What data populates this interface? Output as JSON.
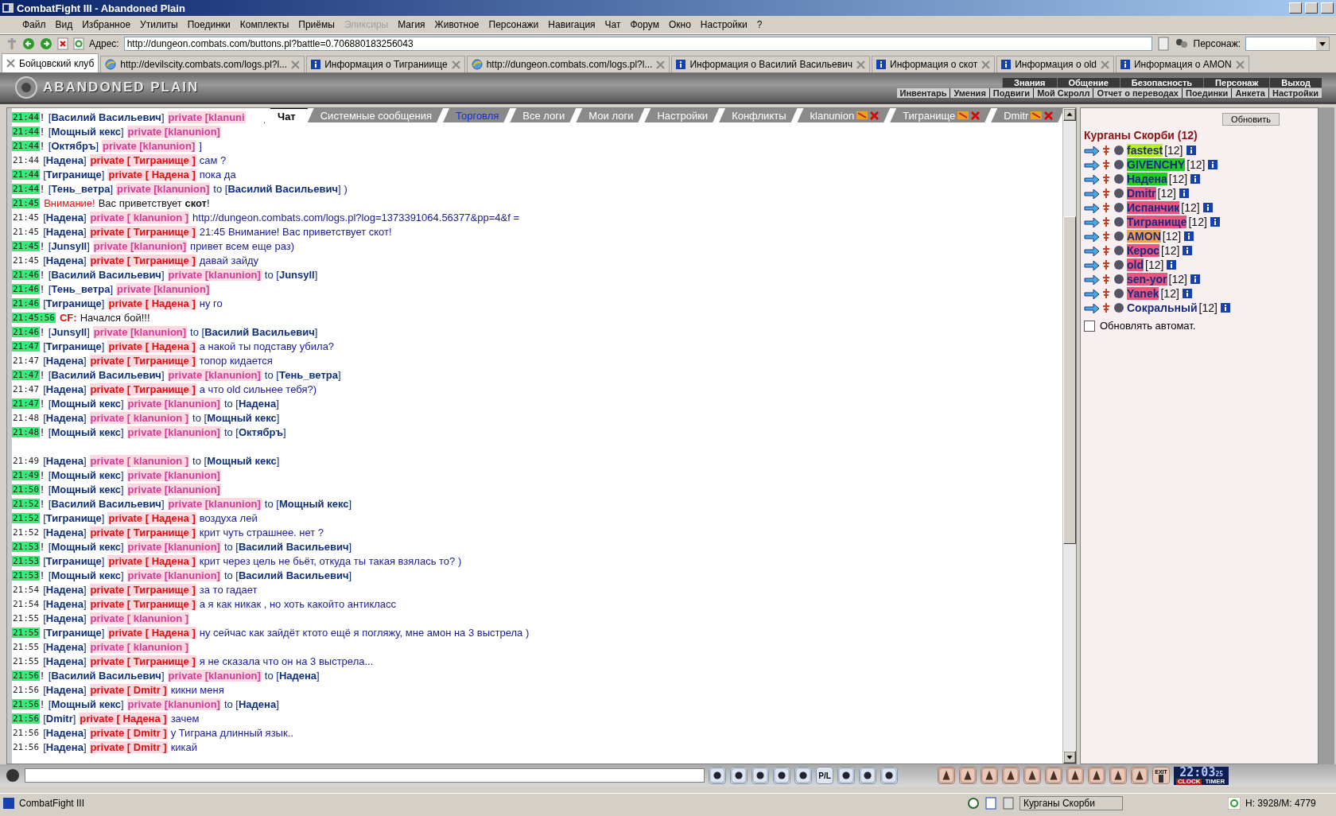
{
  "window": {
    "title": "CombatFight III - Abandoned Plain"
  },
  "menu": [
    {
      "label": "Файл",
      "disabled": false
    },
    {
      "label": "Вид",
      "disabled": false
    },
    {
      "label": "Избранное",
      "disabled": false
    },
    {
      "label": "Утилиты",
      "disabled": false
    },
    {
      "label": "Поединки",
      "disabled": false
    },
    {
      "label": "Комплекты",
      "disabled": false
    },
    {
      "label": "Приёмы",
      "disabled": false
    },
    {
      "label": "Эликсиры",
      "disabled": true
    },
    {
      "label": "Магия",
      "disabled": false
    },
    {
      "label": "Животное",
      "disabled": false
    },
    {
      "label": "Персонажи",
      "disabled": false
    },
    {
      "label": "Навигация",
      "disabled": false
    },
    {
      "label": "Чат",
      "disabled": false
    },
    {
      "label": "Форум",
      "disabled": false
    },
    {
      "label": "Окно",
      "disabled": false
    },
    {
      "label": "Настройки",
      "disabled": false
    },
    {
      "label": "?",
      "disabled": false
    }
  ],
  "toolbar": {
    "address_label": "Адрес:",
    "address": "http://dungeon.combats.com/buttons.pl?battle=0.706880183256043",
    "character_label": "Персонаж:"
  },
  "browser_tabs": [
    {
      "label": "Бойцовский клуб",
      "kind": "main",
      "selected": true
    },
    {
      "label": "http://devilscity.combats.com/logs.pl?l...",
      "kind": "web",
      "selected": false
    },
    {
      "label": "Информация о Тиграниище",
      "kind": "info",
      "selected": false
    },
    {
      "label": "http://dungeon.combats.com/logs.pl?l...",
      "kind": "web",
      "selected": false
    },
    {
      "label": "Информация о Василий Васильевич",
      "kind": "info",
      "selected": false
    },
    {
      "label": "Информация о скот",
      "kind": "info",
      "selected": false
    },
    {
      "label": "Информация о old",
      "kind": "info",
      "selected": false
    },
    {
      "label": "Информация о AMON",
      "kind": "info",
      "selected": false
    }
  ],
  "game": {
    "logo": "ABANDONED PLAIN",
    "nav_top": [
      "Знания",
      "Общение",
      "Безопасность",
      "Персонаж",
      "Выход"
    ],
    "nav_bottom": [
      "Инвентарь",
      "Умения",
      "Подвиги",
      "Мой Скролл",
      "Отчет о переводах",
      "Поединки",
      "Анкета",
      "Настройки"
    ]
  },
  "chat_tabs": [
    {
      "label": "Чат",
      "kind": "plain",
      "selected": true
    },
    {
      "label": "Системные сообщения",
      "kind": "plain",
      "selected": false
    },
    {
      "label": "Торговля",
      "kind": "link",
      "selected": false
    },
    {
      "label": "Все логи",
      "kind": "plain",
      "selected": false
    },
    {
      "label": "Мои логи",
      "kind": "plain",
      "selected": false
    },
    {
      "label": "Настройки",
      "kind": "plain",
      "selected": false
    },
    {
      "label": "Конфликты",
      "kind": "plain",
      "selected": false
    },
    {
      "label": "klanunion",
      "kind": "private",
      "selected": false
    },
    {
      "label": "Тигранище",
      "kind": "private",
      "selected": false
    },
    {
      "label": "Dmitr",
      "kind": "private",
      "selected": false
    }
  ],
  "messages": [
    {
      "kind": "private",
      "time": "21:44",
      "highlighted": true,
      "bang": "!",
      "sender": "[**Василий Васильевич**]",
      "channel": "private [klanuni",
      "personal": false
    },
    {
      "kind": "private",
      "time": "21:44",
      "highlighted": true,
      "bang": "!",
      "sender": "[**Мощный кекс**]",
      "channel": "private [klanunion]",
      "personal": false
    },
    {
      "kind": "private",
      "time": "21:44",
      "highlighted": true,
      "bang": "!",
      "sender": "[**Октябръ**]",
      "channel": "private [klanunion]",
      "personal": false,
      "text": "]"
    },
    {
      "kind": "private",
      "time": "21:44",
      "highlighted": false,
      "sender": "[**Надена**]",
      "channel": "private [ Тигранище ]",
      "personal": true,
      "text": "сам ?"
    },
    {
      "kind": "private",
      "time": "21:44",
      "highlighted": true,
      "sender": "[**Тигранище**]",
      "channel": "private [ Надена ]",
      "personal": true,
      "text": "пока да"
    },
    {
      "kind": "private",
      "time": "21:44",
      "highlighted": true,
      "bang": "!",
      "sender": "[**Тень_ветра**]",
      "channel": "private [klanunion]",
      "personal": false,
      "recipient": "to [**Василий Васильевич**]",
      "text": ")"
    },
    {
      "kind": "system",
      "time": "21:45",
      "highlighted": true,
      "label": "Внимание!",
      "text": "Вас приветствует **скот**!"
    },
    {
      "kind": "private",
      "time": "21:45",
      "highlighted": false,
      "sender": "[**Надена**]",
      "channel": "private [ klanunion ]",
      "personal": false,
      "text": "http://dungeon.combats.com/logs.pl?log=1373391064.56377&pp=4&f ="
    },
    {
      "kind": "private",
      "time": "21:45",
      "highlighted": false,
      "sender": "[**Надена**]",
      "channel": "private [ Тигранище ]",
      "personal": true,
      "text": "21:45 Внимание! Вас приветствует скот!"
    },
    {
      "kind": "private",
      "time": "21:45",
      "highlighted": true,
      "bang": "!",
      "sender": "[**Junsyll**]",
      "channel": "private [klanunion]",
      "personal": false,
      "text": "привет всем еще раз)"
    },
    {
      "kind": "private",
      "time": "21:45",
      "highlighted": false,
      "sender": "[**Надена**]",
      "channel": "private [ Тигранище ]",
      "personal": true,
      "text": "давай зайду"
    },
    {
      "kind": "private",
      "time": "21:46",
      "highlighted": true,
      "bang": "!",
      "sender": "[**Василий Васильевич**]",
      "channel": "private [klanunion]",
      "personal": false,
      "recipient": "to [**Junsyll**]"
    },
    {
      "kind": "private",
      "time": "21:46",
      "highlighted": true,
      "bang": "!",
      "sender": "[**Тень_ветра**]",
      "channel": "private [klanunion]",
      "personal": false
    },
    {
      "kind": "private",
      "time": "21:46",
      "highlighted": true,
      "sender": "[**Тигранище**]",
      "channel": "private [ Надена ]",
      "personal": true,
      "text": "ну го"
    },
    {
      "kind": "system",
      "time": "21:45:56",
      "highlighted": true,
      "label": "CF:",
      "text": "Начался бой!!!"
    },
    {
      "kind": "private",
      "time": "21:46",
      "highlighted": true,
      "bang": "!",
      "sender": "[**Junsyll**]",
      "channel": "private [klanunion]",
      "personal": false,
      "recipient": "to [**Василий Васильевич**]"
    },
    {
      "kind": "private",
      "time": "21:47",
      "highlighted": true,
      "sender": "[**Тигранище**]",
      "channel": "private [ Надена ]",
      "personal": true,
      "text": "а накой ты подставу убила?"
    },
    {
      "kind": "private",
      "time": "21:47",
      "highlighted": false,
      "sender": "[**Надена**]",
      "channel": "private [ Тигранище ]",
      "personal": true,
      "text": "топор кидается"
    },
    {
      "kind": "private",
      "time": "21:47",
      "highlighted": true,
      "bang": "!",
      "sender": "[**Василий Васильевич**]",
      "channel": "private [klanunion]",
      "personal": false,
      "recipient": "to [**Тень_ветра**]"
    },
    {
      "kind": "private",
      "time": "21:47",
      "highlighted": false,
      "sender": "[**Надена**]",
      "channel": "private [ Тигранище ]",
      "personal": true,
      "text": "а что old сильнее тебя?)"
    },
    {
      "kind": "private",
      "time": "21:47",
      "highlighted": true,
      "bang": "!",
      "sender": "[**Мощный кекс**]",
      "channel": "private [klanunion]",
      "personal": false,
      "recipient": "to [**Надена**]"
    },
    {
      "kind": "private",
      "time": "21:48",
      "highlighted": false,
      "sender": "[**Надена**]",
      "channel": "private [ klanunion ]",
      "personal": false,
      "recipient": "to [**Мощный кекс**]"
    },
    {
      "kind": "private",
      "time": "21:48",
      "highlighted": true,
      "bang": "!",
      "sender": "[**Мощный кекс**]",
      "channel": "private [klanunion]",
      "personal": false,
      "recipient": "to [**Октябръ**]"
    },
    {
      "kind": "gap"
    },
    {
      "kind": "private",
      "time": "21:49",
      "highlighted": false,
      "sender": "[**Надена**]",
      "channel": "private [ klanunion ]",
      "personal": false,
      "recipient": "to [**Мощный кекс**]"
    },
    {
      "kind": "private",
      "time": "21:49",
      "highlighted": true,
      "bang": "!",
      "sender": "[**Мощный кекс**]",
      "channel": "private [klanunion]",
      "personal": false
    },
    {
      "kind": "private",
      "time": "21:50",
      "highlighted": true,
      "bang": "!",
      "sender": "[**Мощный кекс**]",
      "channel": "private [klanunion]",
      "personal": false
    },
    {
      "kind": "private",
      "time": "21:52",
      "highlighted": true,
      "bang": "!",
      "sender": "[**Василий Васильевич**]",
      "channel": "private [klanunion]",
      "personal": false,
      "recipient": "to [**Мощный кекс**]"
    },
    {
      "kind": "private",
      "time": "21:52",
      "highlighted": true,
      "sender": "[**Тигранище**]",
      "channel": "private [ Надена ]",
      "personal": true,
      "text": "воздуха лей"
    },
    {
      "kind": "private",
      "time": "21:52",
      "highlighted": false,
      "sender": "[**Надена**]",
      "channel": "private [ Тигранище ]",
      "personal": true,
      "text": "крит чуть страшнее. нет ?"
    },
    {
      "kind": "private",
      "time": "21:53",
      "highlighted": true,
      "bang": "!",
      "sender": "[**Мощный кекс**]",
      "channel": "private [klanunion]",
      "personal": false,
      "recipient": "to [**Василий Васильевич**]"
    },
    {
      "kind": "private",
      "time": "21:53",
      "highlighted": true,
      "sender": "[**Тигранище**]",
      "channel": "private [ Надена ]",
      "personal": true,
      "text": "крит через цель не бьёт, откуда ты такая взялась то? )"
    },
    {
      "kind": "private",
      "time": "21:53",
      "highlighted": true,
      "bang": "!",
      "sender": "[**Мощный кекс**]",
      "channel": "private [klanunion]",
      "personal": false,
      "recipient": "to [**Василий Васильевич**]"
    },
    {
      "kind": "private",
      "time": "21:54",
      "highlighted": false,
      "sender": "[**Надена**]",
      "channel": "private [ Тигранище ]",
      "personal": true,
      "text": "за то гадает"
    },
    {
      "kind": "private",
      "time": "21:54",
      "highlighted": false,
      "sender": "[**Надена**]",
      "channel": "private [ Тигранище ]",
      "personal": true,
      "text": "а я как никак , но хоть какойто антикласс"
    },
    {
      "kind": "private",
      "time": "21:55",
      "highlighted": false,
      "sender": "[**Надена**]",
      "channel": "private [ klanunion ]",
      "personal": false
    },
    {
      "kind": "private",
      "time": "21:55",
      "highlighted": true,
      "sender": "[**Тигранище**]",
      "channel": "private [ Надена ]",
      "personal": true,
      "text": "ну сейчас как зайдёт ктото ещё я погляжу, мне амон на 3 выстрела )"
    },
    {
      "kind": "private",
      "time": "21:55",
      "highlighted": false,
      "sender": "[**Надена**]",
      "channel": "private [ klanunion ]",
      "personal": false
    },
    {
      "kind": "private",
      "time": "21:55",
      "highlighted": false,
      "sender": "[**Надена**]",
      "channel": "private [ Тигранище ]",
      "personal": true,
      "text": "я не сказала что он на 3 выстрела..."
    },
    {
      "kind": "private",
      "time": "21:56",
      "highlighted": true,
      "bang": "!",
      "sender": "[**Василий Васильевич**]",
      "channel": "private [klanunion]",
      "personal": false,
      "recipient": "to [**Надена**]"
    },
    {
      "kind": "private",
      "time": "21:56",
      "highlighted": false,
      "sender": "[**Надена**]",
      "channel": "private [ Dmitr ]",
      "personal": true,
      "text": "кикни меня"
    },
    {
      "kind": "private",
      "time": "21:56",
      "highlighted": true,
      "bang": "!",
      "sender": "[**Мощный кекс**]",
      "channel": "private [klanunion]",
      "personal": false,
      "recipient": "to [**Надена**]"
    },
    {
      "kind": "private",
      "time": "21:56",
      "highlighted": true,
      "sender": "[**Dmitr**]",
      "channel": "private [ Надена ]",
      "personal": true,
      "text": "зачем"
    },
    {
      "kind": "private",
      "time": "21:56",
      "highlighted": false,
      "sender": "[**Надена**]",
      "channel": "private [ Dmitr ]",
      "personal": true,
      "text": "у Тиграна длинный язык.."
    },
    {
      "kind": "private",
      "time": "21:56",
      "highlighted": false,
      "sender": "[**Надена**]",
      "channel": "private [ Dmitr ]",
      "personal": true,
      "text": "кикай"
    }
  ],
  "room": {
    "refresh": "Обновить",
    "title": "Курганы Скорби (12)",
    "players": [
      {
        "name": "fastest",
        "level": "[12]",
        "color": "#b8f020"
      },
      {
        "name": "GIVENCHY",
        "level": "[12]",
        "color": "#22cc22"
      },
      {
        "name": "Надена",
        "level": "[12]",
        "color": "#22cc22"
      },
      {
        "name": "Dmitr",
        "level": "[12]",
        "color": "#e8557d"
      },
      {
        "name": "Испанчик",
        "level": "[12]",
        "color": "#e8557d"
      },
      {
        "name": "Тигранище",
        "level": "[12]",
        "color": "#e8557d"
      },
      {
        "name": "AMON",
        "level": "[12]",
        "color": "#f0a048"
      },
      {
        "name": "Керос",
        "level": "[12]",
        "color": "#e8557d"
      },
      {
        "name": "old",
        "level": "[12]",
        "color": "#e8557d"
      },
      {
        "name": "sen-yor",
        "level": "[12]",
        "color": "#e8557d"
      },
      {
        "name": "Yanek",
        "level": "[12]",
        "color": "#e8557d"
      },
      {
        "name": "Сокральный",
        "level": "[12]"
      }
    ],
    "auto_refresh": {
      "label": "Обновлять автомат.",
      "checked": false
    }
  },
  "bottom_bar": {
    "pl_label": "P/L",
    "exit_label": "EXIT",
    "clock": "22:03",
    "seconds": "25",
    "clock_label": "CLOCK",
    "timer_label": "TIMER"
  },
  "status_bar": {
    "app": "CombatFight III",
    "location": "Курганы Скорби",
    "stats": "H: 3928/M: 4779"
  }
}
